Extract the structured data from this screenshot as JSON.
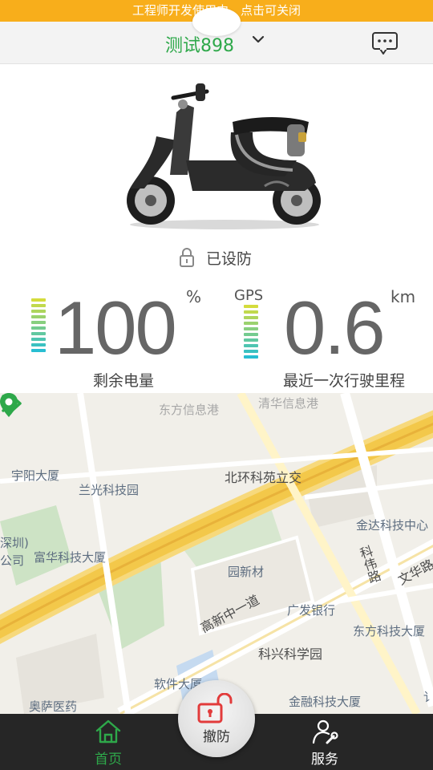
{
  "banner": {
    "text": "工程师开发使用中，点击可关闭"
  },
  "header": {
    "device_name": "测试898"
  },
  "status": {
    "lock_text": "已设防"
  },
  "battery": {
    "value": "100",
    "unit": "%",
    "label": "剩余电量",
    "level": 1.0
  },
  "trip": {
    "gps_label": "GPS",
    "value": "0.6",
    "unit": "km",
    "label": "最近一次行驶里程"
  },
  "map": {
    "labels": {
      "dongfang_info_port": "东方信息港",
      "qinghua_info_port": "清华信息港",
      "yuyang_building": "宇阳大厦",
      "languang_tech_park": "兰光科技园",
      "beihuan_keyuan_interchange": "北环科苑立交",
      "jinda_tech_center": "金达科技中心",
      "shenzhen_partial": "深圳)",
      "company_partial": "公司",
      "fuhua_tech_building": "富华科技大厦",
      "yuan_xincai": "园新材",
      "ke_wei_road": "科伟路",
      "wenhua_road": "文华路",
      "guangfa_bank": "广发银行",
      "dongfang_tech_building": "东方科技大厦",
      "gaoxin_zhong_1st_road": "高新中一道",
      "kexing_science_park": "科兴科学园",
      "software_building": "软件大厦",
      "aosa_pharma": "奥萨医药",
      "jinrong_tech_building": "金融科技大厦",
      "edge_partial": "讠"
    }
  },
  "disarm_button": {
    "label": "撤防"
  },
  "nav": {
    "home_label": "首页",
    "service_label": "服务"
  },
  "colors": {
    "accent_green": "#2ea84a",
    "banner_orange": "#f8ae1b",
    "nav_bg": "#262626",
    "lock_red": "#e23b3b"
  }
}
